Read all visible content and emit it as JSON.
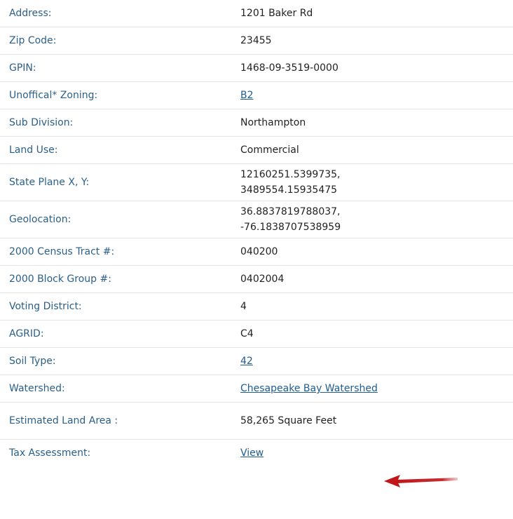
{
  "rows": [
    {
      "label": "Address:",
      "value": "1201 Baker Rd",
      "link": false
    },
    {
      "label": "Zip Code:",
      "value": "23455",
      "link": false
    },
    {
      "label": "GPIN:",
      "value": "1468-09-3519-0000",
      "link": false
    },
    {
      "label": "Unoffical* Zoning:",
      "value": "B2",
      "link": true
    },
    {
      "label": "Sub Division:",
      "value": "Northampton",
      "link": false
    },
    {
      "label": "Land Use:",
      "value": "Commercial",
      "link": false
    },
    {
      "label": "State Plane X, Y:",
      "value_line1": "12160251.5399735,",
      "value_line2": "3489554.15935475"
    },
    {
      "label": "Geolocation:",
      "value_line1": "36.8837819788037,",
      "value_line2": "-76.1838707538959"
    },
    {
      "label": "2000 Census Tract #:",
      "value": "040200",
      "link": false
    },
    {
      "label": "2000 Block Group #:",
      "value": "0402004",
      "link": false
    },
    {
      "label": "Voting District:",
      "value": "4",
      "link": false
    },
    {
      "label": "AGRID:",
      "value": "C4",
      "link": false
    },
    {
      "label": "Soil Type:",
      "value": "42",
      "link": true
    },
    {
      "label": "Watershed:",
      "value": "Chesapeake Bay Watershed",
      "link": true
    },
    {
      "label": "Estimated Land Area :",
      "value": "58,265 Square Feet",
      "link": false
    },
    {
      "label": "Tax Assessment:",
      "value": "View",
      "link": true
    }
  ],
  "annotation": {
    "icon": "red-arrow-left-icon",
    "color": "#c0171b"
  },
  "colors": {
    "label": "#2b5f87",
    "link": "#1f5c8f",
    "value": "#222222",
    "divider": "#e4e4e4"
  }
}
